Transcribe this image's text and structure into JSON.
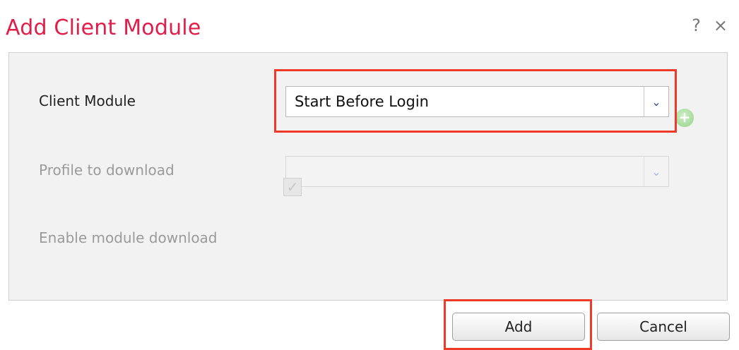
{
  "dialog": {
    "title": "Add Client Module",
    "help_icon": "?",
    "close_icon": "×"
  },
  "form": {
    "client_module": {
      "label": "Client Module",
      "value": "Start Before Login",
      "arrow": "⌄"
    },
    "profile": {
      "label": "Profile to download",
      "value": "",
      "arrow": "⌄",
      "add_icon": "+"
    },
    "enable_download": {
      "label": "Enable module download",
      "checked": true,
      "check_glyph": "✓"
    }
  },
  "buttons": {
    "add": "Add",
    "cancel": "Cancel"
  },
  "colors": {
    "title": "#e11d48",
    "highlight": "#ee3a28",
    "panel": "#f2f2f2",
    "add_icon_green": "#9edb90"
  }
}
